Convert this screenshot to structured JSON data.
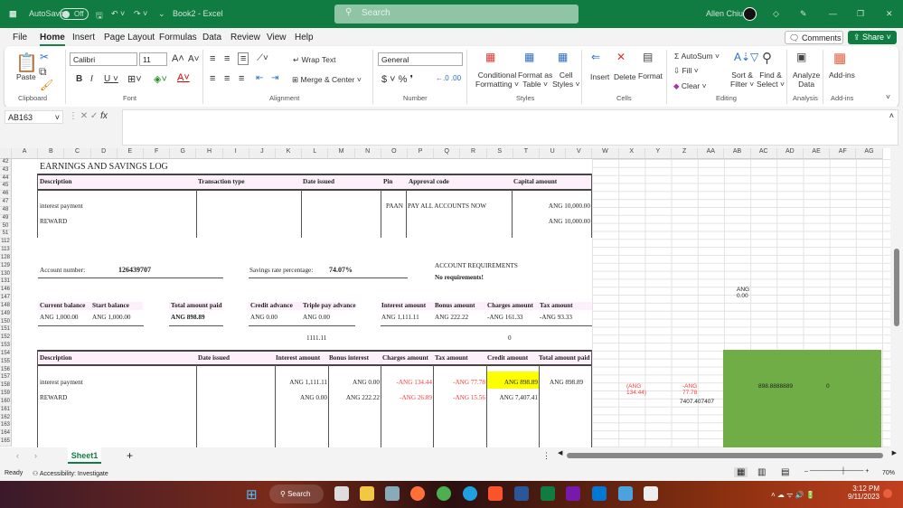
{
  "titlebar": {
    "autosave": "AutoSave",
    "toggle": "Off",
    "doc": "Book2  -  Excel",
    "search": "Search",
    "user": "Allen Chiu"
  },
  "menu": [
    "File",
    "Home",
    "Insert",
    "Page Layout",
    "Formulas",
    "Data",
    "Review",
    "View",
    "Help"
  ],
  "comments": "Comments",
  "share": "Share",
  "ribbon": {
    "paste": "Paste",
    "font": "Calibri",
    "size": "11",
    "wrap": "Wrap Text",
    "merge": "Merge & Center",
    "numfmt": "General",
    "cond1": "Conditional",
    "cond2": "Formatting",
    "fmt1": "Format as",
    "fmt2": "Table",
    "cell1": "Cell",
    "cell2": "Styles",
    "insert": "Insert",
    "delete": "Delete",
    "format": "Format",
    "autosum": "AutoSum",
    "fill": "Fill",
    "clear": "Clear",
    "sort1": "Sort &",
    "sort2": "Filter",
    "find1": "Find &",
    "find2": "Select",
    "an1": "Analyze",
    "an2": "Data",
    "addins": "Add-ins",
    "groups": [
      "Clipboard",
      "Font",
      "Alignment",
      "Number",
      "Styles",
      "Cells",
      "Editing",
      "Analysis",
      "Add-ins"
    ]
  },
  "namebox": "AB163",
  "columns": [
    "A",
    "B",
    "C",
    "D",
    "E",
    "F",
    "G",
    "H",
    "I",
    "J",
    "K",
    "L",
    "M",
    "N",
    "O",
    "P",
    "Q",
    "R",
    "S",
    "T",
    "U",
    "V",
    "W",
    "X",
    "Y",
    "Z",
    "AA",
    "AB",
    "AC",
    "AD",
    "AE",
    "AF",
    "AG"
  ],
  "rows": [
    42,
    43,
    44,
    45,
    46,
    47,
    48,
    49,
    50,
    51,
    112,
    113,
    128,
    129,
    130,
    131,
    146,
    147,
    148,
    149,
    150,
    151,
    152,
    153,
    154,
    155,
    156,
    157,
    158,
    159,
    160,
    161,
    162,
    163,
    164,
    165
  ],
  "sheet": {
    "title": "EARNINGS AND SAVINGS LOG",
    "t1": {
      "headers": [
        "Description",
        "Transaction type",
        "Date issued",
        "Pin",
        "Approval code",
        "Capital amount"
      ],
      "r1": {
        "desc": "interest payment",
        "pin": "PAAN",
        "code": "PAY ALL ACCOUNTS NOW",
        "capital": "ANG 10,000.00"
      },
      "r2": {
        "desc": "REWARD",
        "capital": "ANG 10,000.00"
      }
    },
    "acct_label": "Account number:",
    "acct": "126439707",
    "rate_label": "Savings rate percentage:",
    "rate": "74.07%",
    "req_title": "ACCOUNT REQUIREMENTS",
    "req": "No requirements!",
    "summary": [
      {
        "label": "Current balance",
        "value": "ANG 1,000.00"
      },
      {
        "label": "Start balance",
        "value": "ANG 1,000.00"
      },
      {
        "label": "Total amount paid",
        "value": "ANG 898.89"
      },
      {
        "label": "Credit advance",
        "value": "ANG 0.00"
      },
      {
        "label": "Triple pay advance",
        "value": "ANG 0.00"
      },
      {
        "label": "Interest amount",
        "value": "ANG 1,111.11"
      },
      {
        "label": "Bonus amount",
        "value": "ANG 222.22"
      },
      {
        "label": "Charges amount",
        "value": "-ANG 161.33"
      },
      {
        "label": "Tax amount",
        "value": "-ANG 93.33"
      }
    ],
    "n1": "1111.11",
    "n2": "0",
    "t2": {
      "headers": [
        "Description",
        "Date issued",
        "Interest amount",
        "Bonus interest",
        "Charges amount",
        "Tax amount",
        "Credit amount",
        "Total amount paid"
      ],
      "r1": [
        "interest payment",
        "ANG 1,111.11",
        "ANG 0.00",
        "-ANG 134.44",
        "-ANG 77.78",
        "ANG 898.89",
        "ANG 898.89"
      ],
      "r2": [
        "REWARD",
        "ANG 0.00",
        "ANG 222.22",
        "-ANG 26.89",
        "-ANG 15.56",
        "ANG 7,407.41"
      ]
    },
    "side": {
      "ab146": "ANG 0.00",
      "x158": "(ANG 134.44)",
      "z158": "-ANG 77.78",
      "ac158": "898.8888889",
      "ae158": "0",
      "z160": "7407.407407"
    }
  },
  "sheet_tab": "Sheet1",
  "status": {
    "ready": "Ready",
    "access": "Accessibility: Investigate",
    "zoom": "70%"
  },
  "taskbar": {
    "search": "Search",
    "time": "3:12 PM",
    "date": "9/11/2023"
  },
  "colors": {
    "excel_green": "#107c41",
    "highlight": "#ffff00",
    "green_block": "#70ad47",
    "negative": "#ff3b3b"
  }
}
